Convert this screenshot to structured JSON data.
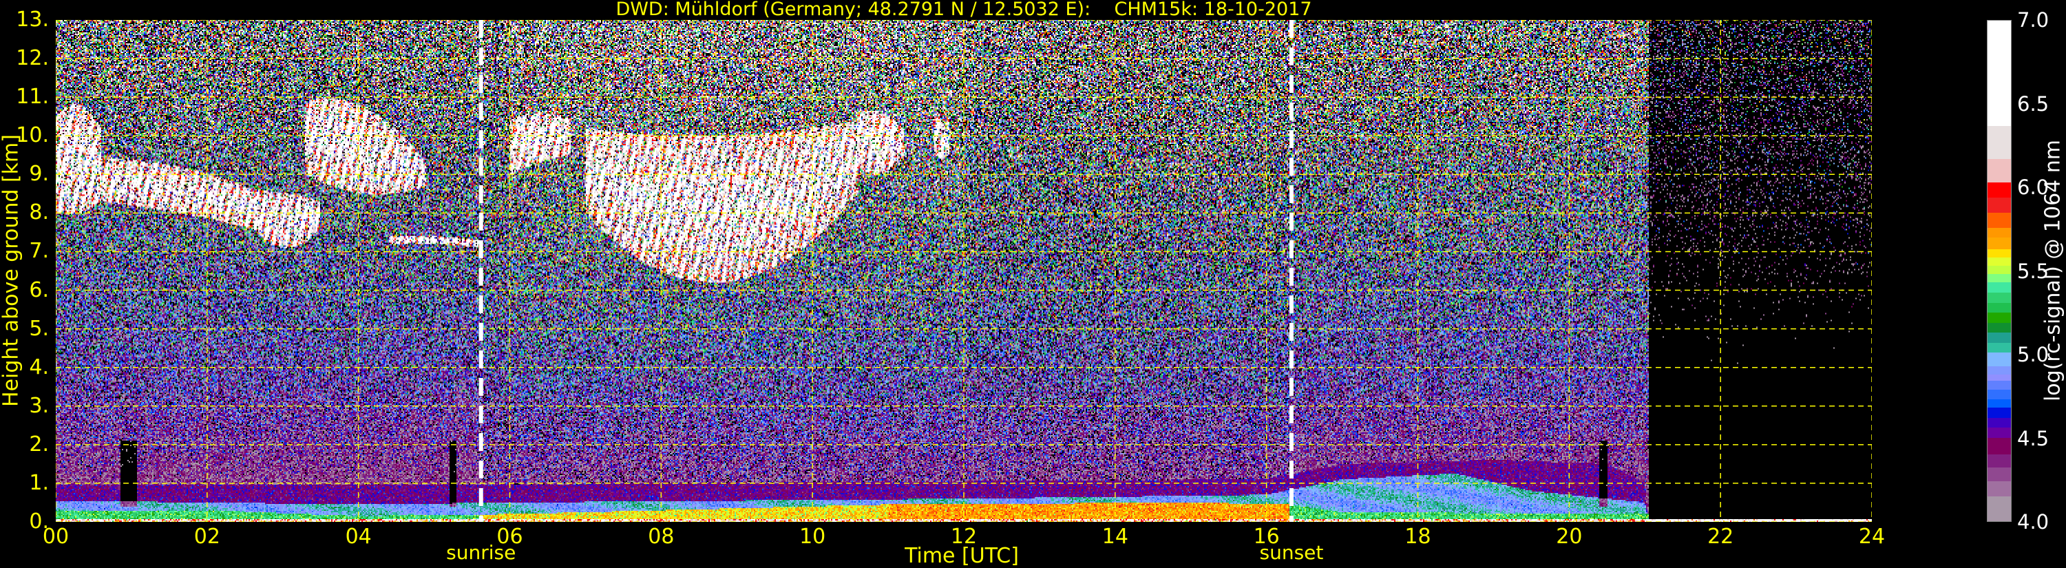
{
  "chart_data": {
    "type": "heatmap",
    "title": "DWD: Mühldorf (Germany; 48.2791 N / 12.5032 E):    CHM15k: 18-10-2017",
    "xlabel": "Time [UTC]",
    "ylabel": "Height above ground [km]",
    "xlim": [
      0,
      24
    ],
    "ylim": [
      0,
      13
    ],
    "x_ticks": [
      "00",
      "02",
      "04",
      "06",
      "08",
      "10",
      "12",
      "14",
      "16",
      "18",
      "20",
      "22",
      "24"
    ],
    "x_tick_values": [
      0,
      2,
      4,
      6,
      8,
      10,
      12,
      14,
      16,
      18,
      20,
      22,
      24
    ],
    "y_ticks": [
      "0.",
      "1.",
      "2.",
      "3.",
      "4.",
      "5.",
      "6.",
      "7.",
      "8.",
      "9.",
      "10.",
      "11.",
      "12.",
      "13."
    ],
    "y_tick_values": [
      0,
      1,
      2,
      3,
      4,
      5,
      6,
      7,
      8,
      9,
      10,
      11,
      12,
      13
    ],
    "grid": true,
    "grid_color": "#ffff00",
    "annotations": [
      {
        "label": "sunrise",
        "time_h": 5.62
      },
      {
        "label": "sunset",
        "time_h": 16.33
      }
    ],
    "colorbar": {
      "label": "log(rc-signal) @ 1064 nm",
      "range": [
        4.0,
        7.0
      ],
      "ticks": [
        "4.0",
        "4.5",
        "5.0",
        "5.5",
        "6.0",
        "6.5",
        "7.0"
      ],
      "tick_values": [
        4.0,
        4.5,
        5.0,
        5.5,
        6.0,
        6.5,
        7.0
      ],
      "below_min_color": "#000000",
      "levels": [
        {
          "from": 4.0,
          "color": "#a898a8"
        },
        {
          "from": 4.15,
          "color": "#a070a0"
        },
        {
          "from": 4.24,
          "color": "#904890"
        },
        {
          "from": 4.32,
          "color": "#802080"
        },
        {
          "from": 4.4,
          "color": "#800060"
        },
        {
          "from": 4.5,
          "color": "#6a00a0"
        },
        {
          "from": 4.56,
          "color": "#4000c0"
        },
        {
          "from": 4.62,
          "color": "#0010e0"
        },
        {
          "from": 4.68,
          "color": "#0060ff"
        },
        {
          "from": 4.73,
          "color": "#3070ff"
        },
        {
          "from": 4.79,
          "color": "#6080ff"
        },
        {
          "from": 4.84,
          "color": "#9090ff"
        },
        {
          "from": 4.88,
          "color": "#8098ff"
        },
        {
          "from": 4.93,
          "color": "#80b8ff"
        },
        {
          "from": 5.01,
          "color": "#30c0a0"
        },
        {
          "from": 5.07,
          "color": "#20a090"
        },
        {
          "from": 5.13,
          "color": "#109030"
        },
        {
          "from": 5.19,
          "color": "#20a800"
        },
        {
          "from": 5.25,
          "color": "#20c050"
        },
        {
          "from": 5.31,
          "color": "#30d070"
        },
        {
          "from": 5.37,
          "color": "#40e8a0"
        },
        {
          "from": 5.43,
          "color": "#80ff80"
        },
        {
          "from": 5.48,
          "color": "#c0ff40"
        },
        {
          "from": 5.53,
          "color": "#e0ff30"
        },
        {
          "from": 5.58,
          "color": "#ffe000"
        },
        {
          "from": 5.63,
          "color": "#ffa800"
        },
        {
          "from": 5.7,
          "color": "#ff9800"
        },
        {
          "from": 5.76,
          "color": "#ff6000"
        },
        {
          "from": 5.85,
          "color": "#f02020"
        },
        {
          "from": 5.94,
          "color": "#ff0000"
        },
        {
          "from": 6.03,
          "color": "#f0c0c0"
        },
        {
          "from": 6.17,
          "color": "#e8e0e0"
        },
        {
          "from": 6.37,
          "color": "#ffffff"
        }
      ]
    },
    "cloud_layers": [
      {
        "t": [
          0.0,
          0.6
        ],
        "base_km": [
          8.0,
          8.0,
          8.3
        ],
        "top_km": [
          10.5,
          10.8,
          10.2
        ]
      },
      {
        "t": [
          0.6,
          2.6
        ],
        "base_km": [
          8.3,
          8.0,
          7.6
        ],
        "top_km": [
          9.4,
          9.2,
          8.6
        ]
      },
      {
        "t": [
          2.6,
          3.5
        ],
        "base_km": [
          7.6,
          7.1,
          7.6
        ],
        "top_km": [
          8.6,
          8.5,
          8.3
        ]
      },
      {
        "t": [
          3.3,
          4.9
        ],
        "base_km": [
          9.0,
          8.5,
          8.7
        ],
        "top_km": [
          10.9,
          10.7,
          9.3
        ]
      },
      {
        "t": [
          4.4,
          5.6
        ],
        "base_km": [
          7.2,
          7.2,
          7.1
        ],
        "top_km": [
          7.4,
          7.4,
          7.3
        ]
      },
      {
        "t": [
          6.0,
          6.8
        ],
        "base_km": [
          9.0,
          9.3,
          9.5
        ],
        "top_km": [
          10.4,
          10.6,
          10.4
        ]
      },
      {
        "t": [
          7.0,
          10.6
        ],
        "base_km": [
          8.0,
          6.2,
          8.5
        ],
        "top_km": [
          10.2,
          10.0,
          10.4
        ]
      },
      {
        "t": [
          10.6,
          11.2
        ],
        "base_km": [
          9.2,
          9.0,
          9.5
        ],
        "top_km": [
          10.6,
          10.6,
          10.2
        ]
      },
      {
        "t": [
          11.6,
          11.8
        ],
        "base_km": [
          9.5,
          9.4,
          9.5
        ],
        "top_km": [
          10.5,
          10.4,
          10.0
        ]
      }
    ]
  }
}
